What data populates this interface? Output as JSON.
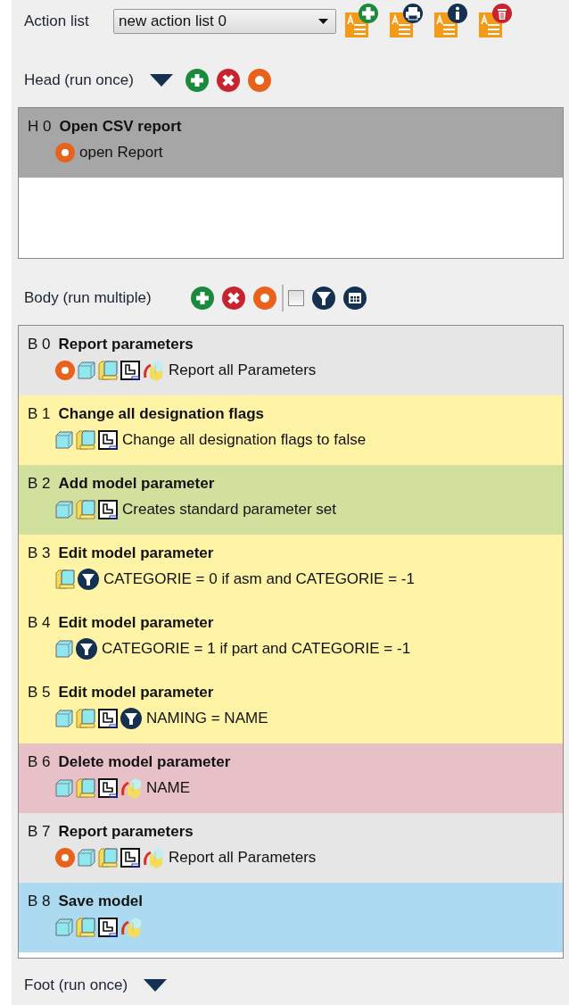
{
  "action_list": {
    "label": "Action list",
    "value": "new action list 0",
    "tools": [
      {
        "kind": "add"
      },
      {
        "kind": "print"
      },
      {
        "kind": "info"
      },
      {
        "kind": "delete"
      }
    ]
  },
  "head": {
    "label": "Head (run once)",
    "tools": [
      {
        "kind": "add"
      },
      {
        "kind": "remove"
      },
      {
        "kind": "run"
      }
    ],
    "items": [
      {
        "code": "H 0",
        "title": "Open CSV report",
        "color": "#a6a6a6",
        "icons": [
          {
            "kind": "report"
          }
        ],
        "description": "open Report"
      }
    ]
  },
  "body": {
    "label": "Body (run multiple)",
    "tools": [
      {
        "kind": "add"
      },
      {
        "kind": "remove"
      },
      {
        "kind": "run"
      },
      {
        "kind": "separator"
      },
      {
        "kind": "checkbox",
        "checked": false
      },
      {
        "kind": "filter"
      },
      {
        "kind": "table"
      }
    ],
    "items": [
      {
        "code": "B 0",
        "title": "Report parameters",
        "color": "#e6e6e6",
        "icons": [
          {
            "kind": "report"
          },
          {
            "kind": "part"
          },
          {
            "kind": "assembly"
          },
          {
            "kind": "drawing"
          },
          {
            "kind": "family"
          }
        ],
        "description": "Report all Parameters"
      },
      {
        "code": "B 1",
        "title": "Change all designation flags",
        "color": "#fff3a6",
        "icons": [
          {
            "kind": "part"
          },
          {
            "kind": "assembly"
          },
          {
            "kind": "drawing"
          }
        ],
        "description": "Change all designation flags to false"
      },
      {
        "code": "B 2",
        "title": "Add model parameter",
        "color": "#d2e09e",
        "icons": [
          {
            "kind": "part"
          },
          {
            "kind": "assembly"
          },
          {
            "kind": "drawing"
          }
        ],
        "description": "Creates standard parameter set"
      },
      {
        "code": "B 3",
        "title": "Edit model parameter",
        "color": "#fff3a6",
        "icons": [
          {
            "kind": "assembly"
          },
          {
            "kind": "filter"
          }
        ],
        "description": "CATEGORIE = 0 if asm and CATEGORIE = -1"
      },
      {
        "code": "B 4",
        "title": "Edit model parameter",
        "color": "#fff3a6",
        "icons": [
          {
            "kind": "part"
          },
          {
            "kind": "filter"
          }
        ],
        "description": "CATEGORIE = 1 if part and CATEGORIE = -1"
      },
      {
        "code": "B 5",
        "title": "Edit model parameter",
        "color": "#fff3a6",
        "icons": [
          {
            "kind": "part"
          },
          {
            "kind": "assembly"
          },
          {
            "kind": "drawing"
          },
          {
            "kind": "filter"
          }
        ],
        "description": "NAMING = NAME"
      },
      {
        "code": "B 6",
        "title": "Delete model parameter",
        "color": "#e8c1c8",
        "icons": [
          {
            "kind": "part"
          },
          {
            "kind": "assembly"
          },
          {
            "kind": "drawing"
          },
          {
            "kind": "family"
          }
        ],
        "description": "NAME"
      },
      {
        "code": "B 7",
        "title": "Report parameters",
        "color": "#e6e6e6",
        "icons": [
          {
            "kind": "report"
          },
          {
            "kind": "part"
          },
          {
            "kind": "assembly"
          },
          {
            "kind": "drawing"
          },
          {
            "kind": "family"
          }
        ],
        "description": "Report all Parameters"
      },
      {
        "code": "B 8",
        "title": "Save model",
        "color": "#abdaf1",
        "icons": [
          {
            "kind": "part"
          },
          {
            "kind": "assembly"
          },
          {
            "kind": "drawing"
          },
          {
            "kind": "family"
          }
        ]
      }
    ]
  },
  "foot": {
    "label": "Foot (run once)"
  }
}
